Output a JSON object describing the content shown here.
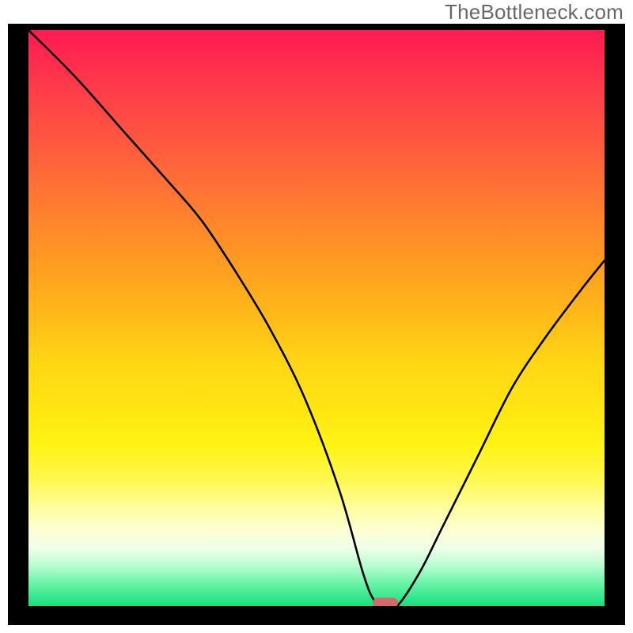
{
  "watermark": "TheBottleneck.com",
  "chart_data": {
    "type": "line",
    "title": "",
    "xlabel": "",
    "ylabel": "",
    "x_range": [
      0,
      100
    ],
    "y_range": [
      0,
      100
    ],
    "background": "heatmap-gradient red-to-green top-to-bottom",
    "series": [
      {
        "name": "bottleneck-curve",
        "x": [
          0,
          8,
          16,
          24,
          30,
          36,
          42,
          48,
          54,
          58,
          60,
          62,
          64,
          68,
          72,
          78,
          84,
          90,
          96,
          100
        ],
        "y": [
          100,
          92,
          83,
          74,
          67,
          58,
          48,
          36,
          20,
          6,
          1,
          0,
          0,
          6,
          14,
          26,
          38,
          47,
          55,
          60
        ]
      }
    ],
    "minimum_marker": {
      "x": 62,
      "y": 0
    },
    "colors": {
      "curve": "#000000",
      "marker": "#d36a6a",
      "gradient_top": "#ff1a52",
      "gradient_bottom": "#15e07c",
      "plot_border": "#000000"
    }
  }
}
